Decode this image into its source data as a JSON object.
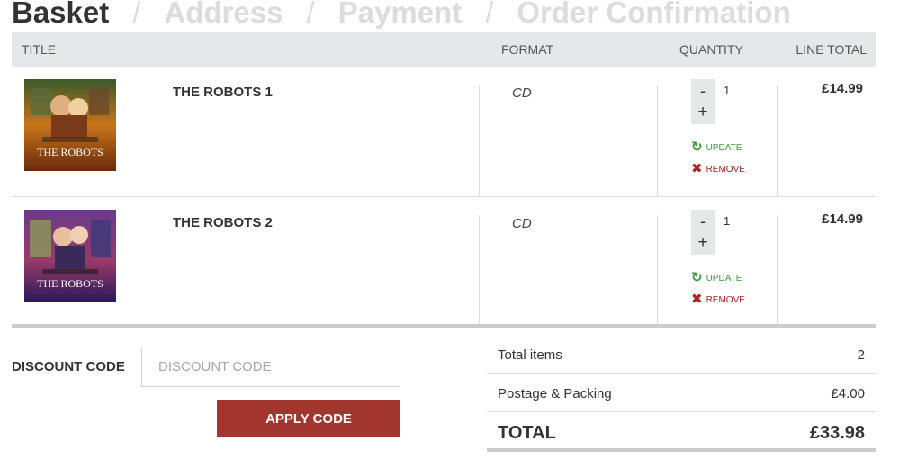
{
  "steps": [
    {
      "label": "Basket",
      "active": true
    },
    {
      "label": "Address",
      "active": false
    },
    {
      "label": "Payment",
      "active": false
    },
    {
      "label": "Order Confirmation",
      "active": false
    }
  ],
  "step_separator": "/",
  "table": {
    "headers": {
      "title": "TITLE",
      "format": "FORMAT",
      "quantity": "QUANTITY",
      "line_total": "LINE TOTAL"
    },
    "rows": [
      {
        "title": "THE ROBOTS 1",
        "format": "CD",
        "quantity": "1",
        "line_total": "£14.99",
        "cover_label": "THE ROBOTS",
        "cover_color": "#c8741a"
      },
      {
        "title": "THE ROBOTS 2",
        "format": "CD",
        "quantity": "1",
        "line_total": "£14.99",
        "cover_label": "THE ROBOTS",
        "cover_color": "#5a2a7a"
      }
    ],
    "actions": {
      "minus": "-",
      "plus": "+",
      "update": "UPDATE",
      "remove": "REMOVE"
    },
    "icons": {
      "update": "refresh-icon",
      "remove": "close-icon"
    }
  },
  "discount": {
    "label": "DISCOUNT CODE",
    "placeholder": "DISCOUNT CODE",
    "value": "",
    "button": "APPLY CODE"
  },
  "totals": {
    "items_label": "Total items",
    "items_value": "2",
    "postage_label": "Postage & Packing",
    "postage_value": "£4.00",
    "total_label": "TOTAL",
    "total_value": "£33.98"
  },
  "colors": {
    "accent": "#a3352f",
    "update": "#3a9a3a",
    "remove": "#b22222",
    "header_bg": "#e6e7e8"
  }
}
